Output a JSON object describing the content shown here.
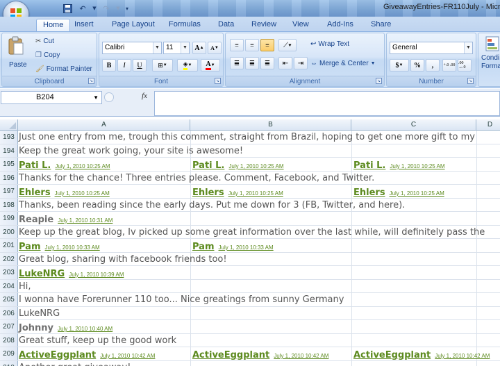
{
  "window": {
    "title": "GiveawayEntries-FR110July - Micro"
  },
  "tabs": [
    "Home",
    "Insert",
    "Page Layout",
    "Formulas",
    "Data",
    "Review",
    "View",
    "Add-Ins",
    "Share"
  ],
  "ribbon": {
    "clipboard": {
      "label": "Clipboard",
      "paste": "Paste",
      "cut": "Cut",
      "copy": "Copy",
      "format_painter": "Format Painter"
    },
    "font": {
      "label": "Font",
      "family": "Calibri",
      "size": "11",
      "grow": "A",
      "shrink": "A",
      "bold": "B",
      "italic": "I",
      "underline": "U",
      "font_color": "A"
    },
    "alignment": {
      "label": "Alignment",
      "wrap_text": "Wrap Text",
      "merge_center": "Merge & Center"
    },
    "number": {
      "label": "Number",
      "format": "General",
      "currency": "$",
      "percent": "%",
      "comma": ",",
      "inc_decimal": "+.0 .00",
      "dec_decimal": ".00 →.0"
    },
    "styles": {
      "conditional": "Condi",
      "format": "Forma"
    }
  },
  "formula_bar": {
    "name_box": "B204",
    "fx": "fx",
    "value": ""
  },
  "columns": [
    "A",
    "B",
    "C",
    "D"
  ],
  "rows": [
    {
      "num": "193",
      "type": "text",
      "text": "Just one entry from me, trough this comment, straight from Brazil, hoping to get one more gift to my"
    },
    {
      "num": "194",
      "type": "text",
      "text": "Keep the great work going, your site is awesome!"
    },
    {
      "num": "195",
      "type": "entries",
      "entries": [
        {
          "name": "Pati L.",
          "date": "July 1, 2010 10:25 AM"
        },
        {
          "name": "Pati L.",
          "date": "July 1, 2010 10:25 AM"
        },
        {
          "name": "Pati L.",
          "date": "July 1, 2010 10:25 AM"
        }
      ]
    },
    {
      "num": "196",
      "type": "text",
      "text": "Thanks for the chance! Three entries please. Comment, Facebook, and Twitter."
    },
    {
      "num": "197",
      "type": "entries",
      "entries": [
        {
          "name": "Ehlers",
          "date": "July 1, 2010 10:25 AM"
        },
        {
          "name": "Ehlers",
          "date": "July 1, 2010 10:25 AM"
        },
        {
          "name": "Ehlers",
          "date": "July 1, 2010 10:25 AM"
        }
      ]
    },
    {
      "num": "198",
      "type": "text",
      "text": "Thanks, been reading since the early days. Put me down for 3 (FB, Twitter, and here)."
    },
    {
      "num": "199",
      "type": "entries",
      "gray": true,
      "entries": [
        {
          "name": "Reapie",
          "date": "July 1, 2010 10:31 AM"
        }
      ]
    },
    {
      "num": "200",
      "type": "text",
      "text": "Keep up the great blog, Iv picked up some great information over the last while, will definitely pass the"
    },
    {
      "num": "201",
      "type": "entries",
      "entries": [
        {
          "name": "Pam",
          "date": "July 1, 2010 10:33 AM"
        },
        {
          "name": "Pam",
          "date": "July 1, 2010 10:33 AM"
        }
      ]
    },
    {
      "num": "202",
      "type": "text",
      "text": "Great blog, sharing with facebook friends too!"
    },
    {
      "num": "203",
      "type": "entries",
      "entries": [
        {
          "name": "LukeNRG",
          "date": "July 1, 2010 10:39 AM"
        }
      ]
    },
    {
      "num": "204",
      "type": "text",
      "text": "Hi,"
    },
    {
      "num": "205",
      "type": "text",
      "text": "I wonna have Forerunner 110 too... Nice greatings from sunny Germany"
    },
    {
      "num": "206",
      "type": "text",
      "text": "LukeNRG"
    },
    {
      "num": "207",
      "type": "entries",
      "gray": true,
      "entries": [
        {
          "name": "Johnny",
          "date": "July 1, 2010 10:40 AM"
        }
      ]
    },
    {
      "num": "208",
      "type": "text",
      "text": "Great stuff, keep up the good work"
    },
    {
      "num": "209",
      "type": "entries",
      "entries": [
        {
          "name": "ActiveEggplant",
          "date": "July 1, 2010 10:42 AM"
        },
        {
          "name": "ActiveEggplant",
          "date": "July 1, 2010 10:42 AM"
        },
        {
          "name": "ActiveEggplant",
          "date": "July 1, 2010 10:42 AM"
        }
      ]
    },
    {
      "num": "210",
      "type": "text",
      "text": "Another great giveaway!"
    }
  ]
}
